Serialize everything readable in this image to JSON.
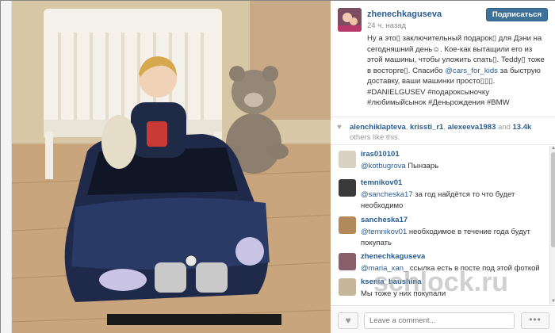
{
  "post": {
    "username": "zhenechkaguseva",
    "time_ago": "24 ч. назад",
    "follow_label": "Подписаться",
    "caption_parts": {
      "p1": "Ну а это▯ заключительный подарок▯ для Дэни на сегодняшний день☺. Кое-как вытащили его из этой машины, чтобы уложить спать▯. Teddy▯ тоже в восторге▯. Спасибо ",
      "mention": "@cars_for_kids",
      "p2": " за быструю доставку, ваши машинки просто▯▯▯. #DANIELGUSEV #подароксыночку #любимыйсынок #Деньрождения #BMW"
    }
  },
  "likes": {
    "heart_icon": "heart-icon",
    "user1": "alenchiklapteva",
    "user2": "krissti_r1",
    "user3": "alexeeva1983",
    "and_label": "and",
    "count": "13.4k",
    "others_label": "others like this."
  },
  "comments": [
    {
      "user": "iras010101",
      "mention": "@kotbugrova",
      "text": " Пынзарь"
    },
    {
      "user": "temnikov01",
      "mention": "@sancheska17",
      "text": " за год найдётся то что будет необходимо"
    },
    {
      "user": "sancheska17",
      "mention": "@temnikov01",
      "text": " необходимое в течение года будут покупать"
    },
    {
      "user": "zhenechkaguseva",
      "mention": "@maria_xan_",
      "text": " ссылка есть в посте под этой фоткой"
    },
    {
      "user": "ksenia_baushina",
      "mention": "",
      "text": "Мы тоже у них покупали"
    }
  ],
  "footer": {
    "comment_placeholder": "Leave a comment...",
    "more_label": "•••"
  },
  "watermark": "schlock.ru"
}
